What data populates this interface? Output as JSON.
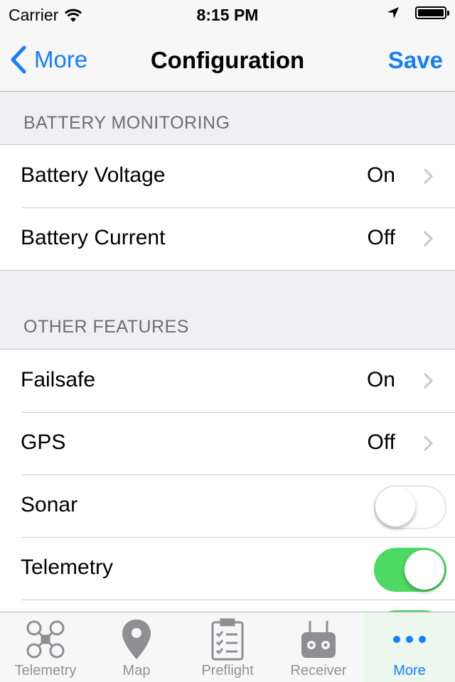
{
  "status_bar": {
    "carrier": "Carrier",
    "time": "8:15 PM"
  },
  "nav": {
    "back_label": "More",
    "title": "Configuration",
    "save_label": "Save"
  },
  "sections": [
    {
      "header": "BATTERY MONITORING",
      "rows": [
        {
          "label": "Battery Voltage",
          "value": "On"
        },
        {
          "label": "Battery Current",
          "value": "Off"
        }
      ]
    },
    {
      "header": "OTHER FEATURES",
      "rows": [
        {
          "label": "Failsafe",
          "value": "On"
        },
        {
          "label": "GPS",
          "value": "Off"
        },
        {
          "label": "Sonar",
          "toggle": false
        },
        {
          "label": "Telemetry",
          "toggle": true
        }
      ]
    }
  ],
  "tabs": [
    {
      "label": "Telemetry",
      "icon": "quadcopter-icon",
      "active": false
    },
    {
      "label": "Map",
      "icon": "map-pin-icon",
      "active": false
    },
    {
      "label": "Preflight",
      "icon": "clipboard-checklist-icon",
      "active": false
    },
    {
      "label": "Receiver",
      "icon": "remote-controller-icon",
      "active": false
    },
    {
      "label": "More",
      "icon": "more-dots-icon",
      "active": true
    }
  ],
  "colors": {
    "accent": "#157efb",
    "toggle_on": "#4cd964",
    "background": "#efeff4"
  }
}
